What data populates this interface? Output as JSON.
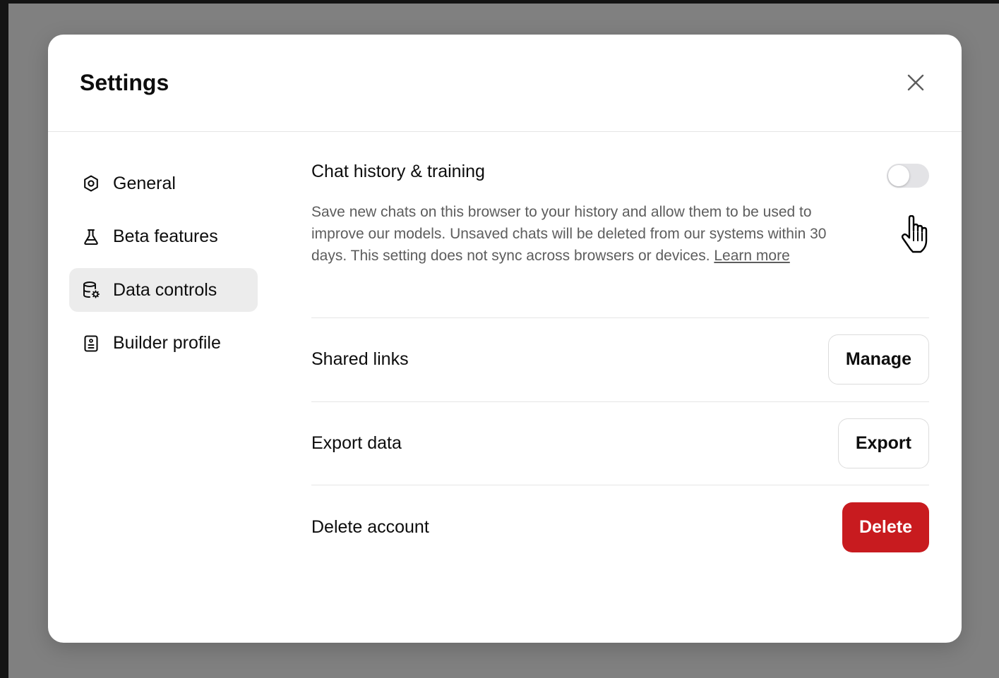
{
  "modal": {
    "title": "Settings",
    "close_icon": "close-icon"
  },
  "sidebar": {
    "items": [
      {
        "label": "General",
        "icon": "gear-icon",
        "active": false
      },
      {
        "label": "Beta features",
        "icon": "flask-icon",
        "active": false
      },
      {
        "label": "Data controls",
        "icon": "database-settings-icon",
        "active": true
      },
      {
        "label": "Builder profile",
        "icon": "id-card-icon",
        "active": false
      }
    ]
  },
  "data_controls": {
    "chat_history": {
      "title": "Chat history & training",
      "description": "Save new chats on this browser to your history and allow them to be used to improve our models. Unsaved chats will be deleted from our systems within 30 days. This setting does not sync across browsers or devices.",
      "learn_more": "Learn more",
      "enabled": false
    },
    "shared_links": {
      "label": "Shared links",
      "button": "Manage"
    },
    "export_data": {
      "label": "Export data",
      "button": "Export"
    },
    "delete_account": {
      "label": "Delete account",
      "button": "Delete"
    }
  },
  "colors": {
    "backdrop": "#808080",
    "danger": "#c81b1f",
    "active_nav": "#ececec",
    "toggle_off": "#e3e3e6"
  }
}
